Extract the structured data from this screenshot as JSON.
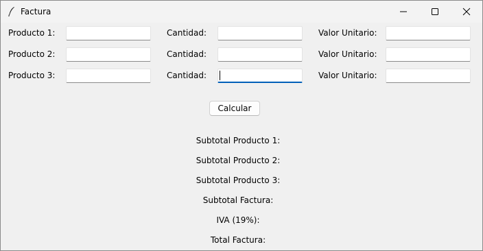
{
  "window": {
    "title": "Factura",
    "icon": "feather-icon"
  },
  "rows": [
    {
      "product_label": "Producto 1:",
      "quantity_label": "Cantidad:",
      "unit_value_label": "Valor Unitario:",
      "product_value": "",
      "quantity_value": "",
      "unit_value": ""
    },
    {
      "product_label": "Producto 2:",
      "quantity_label": "Cantidad:",
      "unit_value_label": "Valor Unitario:",
      "product_value": "",
      "quantity_value": "",
      "unit_value": ""
    },
    {
      "product_label": "Producto 3:",
      "quantity_label": "Cantidad:",
      "unit_value_label": "Valor Unitario:",
      "product_value": "",
      "quantity_value": "",
      "unit_value": ""
    }
  ],
  "calculate_label": "Calcular",
  "results": {
    "subtotal_1": "Subtotal Producto 1:",
    "subtotal_2": "Subtotal Producto 2:",
    "subtotal_3": "Subtotal Producto 3:",
    "subtotal_invoice": "Subtotal Factura:",
    "iva": "IVA (19%):",
    "total": "Total Factura:"
  },
  "colors": {
    "background": "#f0f0f0",
    "focus_accent": "#005fb8"
  }
}
